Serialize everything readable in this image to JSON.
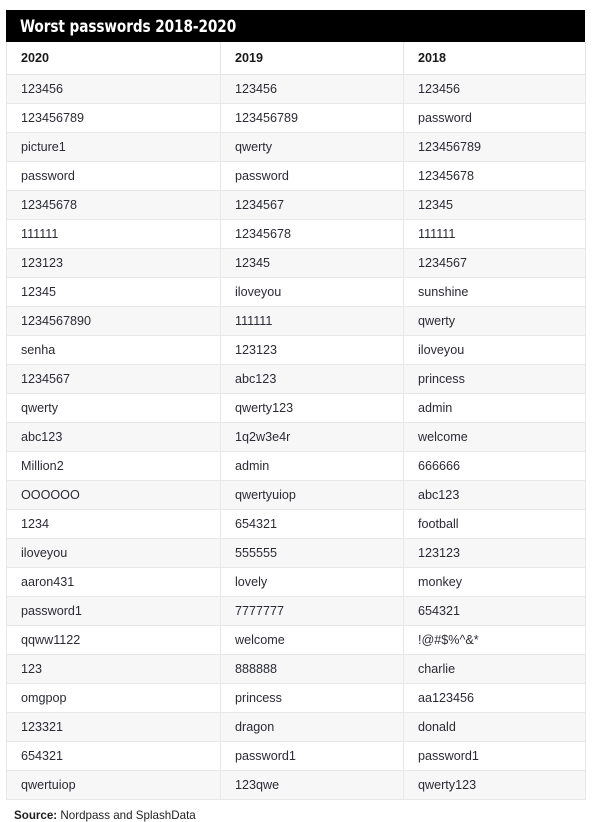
{
  "title": "Worst passwords 2018-2020",
  "columns": [
    "2020",
    "2019",
    "2018"
  ],
  "rows": [
    [
      "123456",
      "123456",
      "123456"
    ],
    [
      "123456789",
      "123456789",
      "password"
    ],
    [
      "picture1",
      "qwerty",
      "123456789"
    ],
    [
      "password",
      "password",
      "12345678"
    ],
    [
      "12345678",
      "1234567",
      "12345"
    ],
    [
      "111111",
      "12345678",
      "111111"
    ],
    [
      "123123",
      "12345",
      "1234567"
    ],
    [
      "12345",
      "iloveyou",
      "sunshine"
    ],
    [
      "1234567890",
      "111111",
      "qwerty"
    ],
    [
      "senha",
      "123123",
      "iloveyou"
    ],
    [
      "1234567",
      "abc123",
      "princess"
    ],
    [
      "qwerty",
      "qwerty123",
      "admin"
    ],
    [
      "abc123",
      "1q2w3e4r",
      "welcome"
    ],
    [
      "Million2",
      "admin",
      "666666"
    ],
    [
      "OOOOOO",
      "qwertyuiop",
      "abc123"
    ],
    [
      "1234",
      "654321",
      "football"
    ],
    [
      "iloveyou",
      "555555",
      "123123"
    ],
    [
      "aaron431",
      "lovely",
      "monkey"
    ],
    [
      "password1",
      "7777777",
      "654321"
    ],
    [
      "qqww1122",
      "welcome",
      "!@#$%^&*"
    ],
    [
      "123",
      "888888",
      "charlie"
    ],
    [
      "omgpop",
      "princess",
      "aa123456"
    ],
    [
      "123321",
      "dragon",
      "donald"
    ],
    [
      "654321",
      "password1",
      "password1"
    ],
    [
      "qwertuiop",
      "123qwe",
      "qwerty123"
    ]
  ],
  "source": {
    "label": "Source:",
    "text": " Nordpass and SplashData"
  },
  "colors": {
    "header_bg": "#000000",
    "header_text": "#ffffff",
    "stripe": "#f7f7f7",
    "text": "#2b2b36",
    "border": "#e8e8e8"
  }
}
